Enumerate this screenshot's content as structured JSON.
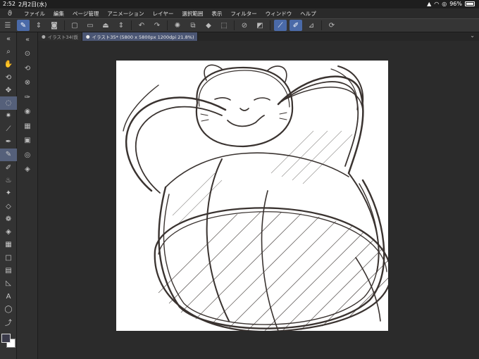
{
  "status": {
    "time": "2:52",
    "date": "2月2日(水)",
    "battery": "96%",
    "battery_level": 0.96
  },
  "menu": [
    "ファイル",
    "編集",
    "ページ管理",
    "アニメーション",
    "レイヤー",
    "選択範囲",
    "表示",
    "フィルター",
    "ウィンドウ",
    "ヘルプ"
  ],
  "tabs": [
    {
      "label": "イラスト34(仮"
    },
    {
      "label": "イラスト35* (5800 x 5800px 1200dpi 21.8%)"
    }
  ],
  "colors": {
    "accent": "#4a6aa8",
    "canvas_bg": "#2b2b2b",
    "paper": "#ffffff",
    "ink": "#3a3330"
  }
}
